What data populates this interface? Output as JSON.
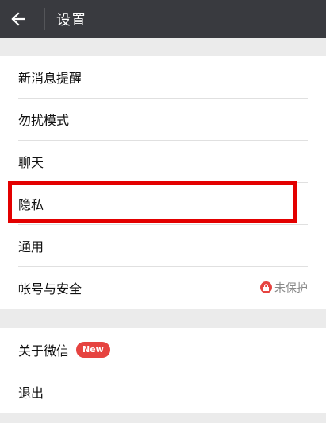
{
  "header": {
    "title": "设置",
    "back_icon": "back-arrow-icon"
  },
  "groups": [
    {
      "items": [
        {
          "label": "新消息提醒"
        },
        {
          "label": "勿扰模式"
        },
        {
          "label": "聊天"
        },
        {
          "label": "隐私"
        },
        {
          "label": "通用"
        },
        {
          "label": "帐号与安全",
          "status": "未保护",
          "status_icon": "lock-icon"
        }
      ]
    },
    {
      "items": [
        {
          "label": "关于微信",
          "badge": "New"
        },
        {
          "label": "退出"
        }
      ]
    }
  ],
  "colors": {
    "header_bg": "#393a3f",
    "page_bg": "#ebebeb",
    "badge_red": "#e64340",
    "highlight_red": "#e30000"
  }
}
